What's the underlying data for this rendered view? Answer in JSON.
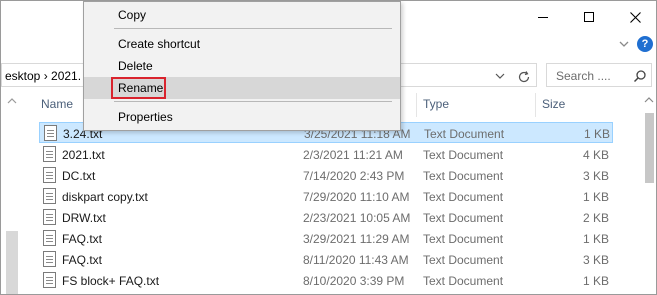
{
  "address": {
    "path": "esktop  ›  2021."
  },
  "search": {
    "placeholder": "Search ...."
  },
  "columns": {
    "name": "Name",
    "type": "Type",
    "size": "Size"
  },
  "files": [
    {
      "name": "3.24.txt",
      "date": "3/25/2021 11:18 AM",
      "type": "Text Document",
      "size": "1 KB"
    },
    {
      "name": "2021.txt",
      "date": "2/3/2021 11:21 AM",
      "type": "Text Document",
      "size": "4 KB"
    },
    {
      "name": "DC.txt",
      "date": "7/14/2020 2:43 PM",
      "type": "Text Document",
      "size": "3 KB"
    },
    {
      "name": "diskpart copy.txt",
      "date": "7/29/2020 11:10 AM",
      "type": "Text Document",
      "size": "1 KB"
    },
    {
      "name": "DRW.txt",
      "date": "2/23/2021 10:05 AM",
      "type": "Text Document",
      "size": "2 KB"
    },
    {
      "name": "FAQ.txt",
      "date": "3/29/2021 11:29 AM",
      "type": "Text Document",
      "size": "1 KB"
    },
    {
      "name": "FAQ.txt",
      "date": "8/11/2020 11:43 AM",
      "type": "Text Document",
      "size": "3 KB"
    },
    {
      "name": "FS block+ FAQ.txt",
      "date": "8/10/2020 3:39 PM",
      "type": "Text Document",
      "size": "1 KB"
    }
  ],
  "context_menu": {
    "copy": "Copy",
    "create_shortcut": "Create shortcut",
    "delete": "Delete",
    "rename": "Rename",
    "properties": "Properties"
  },
  "colors": {
    "selection": "#cce8ff",
    "rename_highlight": "#d9232d",
    "help_icon": "#1f6fd1"
  }
}
